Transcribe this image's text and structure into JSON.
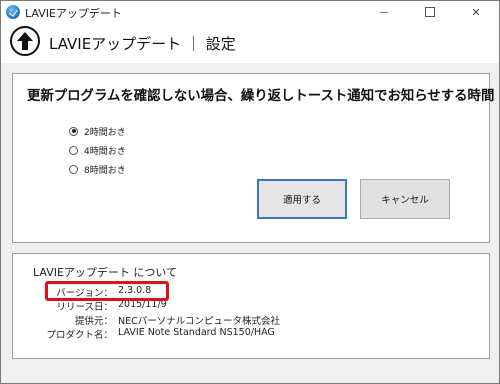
{
  "window": {
    "title": "LAVIEアップデート",
    "controls": {
      "minimize": "—",
      "close": "✕"
    }
  },
  "header": {
    "title": "LAVIEアップデート ｜ 設定"
  },
  "settings": {
    "heading": "更新プログラムを確認しない場合、繰り返しトースト通知でお知らせする時間",
    "options": [
      {
        "label": "2時間おき",
        "checked": true
      },
      {
        "label": "4時間おき",
        "checked": false
      },
      {
        "label": "8時間おき",
        "checked": false
      }
    ],
    "apply_label": "適用する",
    "cancel_label": "キャンセル"
  },
  "about": {
    "heading": "LAVIEアップデート について",
    "rows": [
      {
        "label": "バージョン：",
        "value": "2.3.0.8"
      },
      {
        "label": "リリース日：",
        "value": "2015/11/9"
      },
      {
        "label": "提供元：",
        "value": "NECパーソナルコンピュータ株式会社"
      },
      {
        "label": "プロダクト名：",
        "value": "LAVIE Note Standard NS150/HAG"
      }
    ]
  },
  "colors": {
    "accent": "#3a78c2",
    "highlight": "#e0101a"
  }
}
